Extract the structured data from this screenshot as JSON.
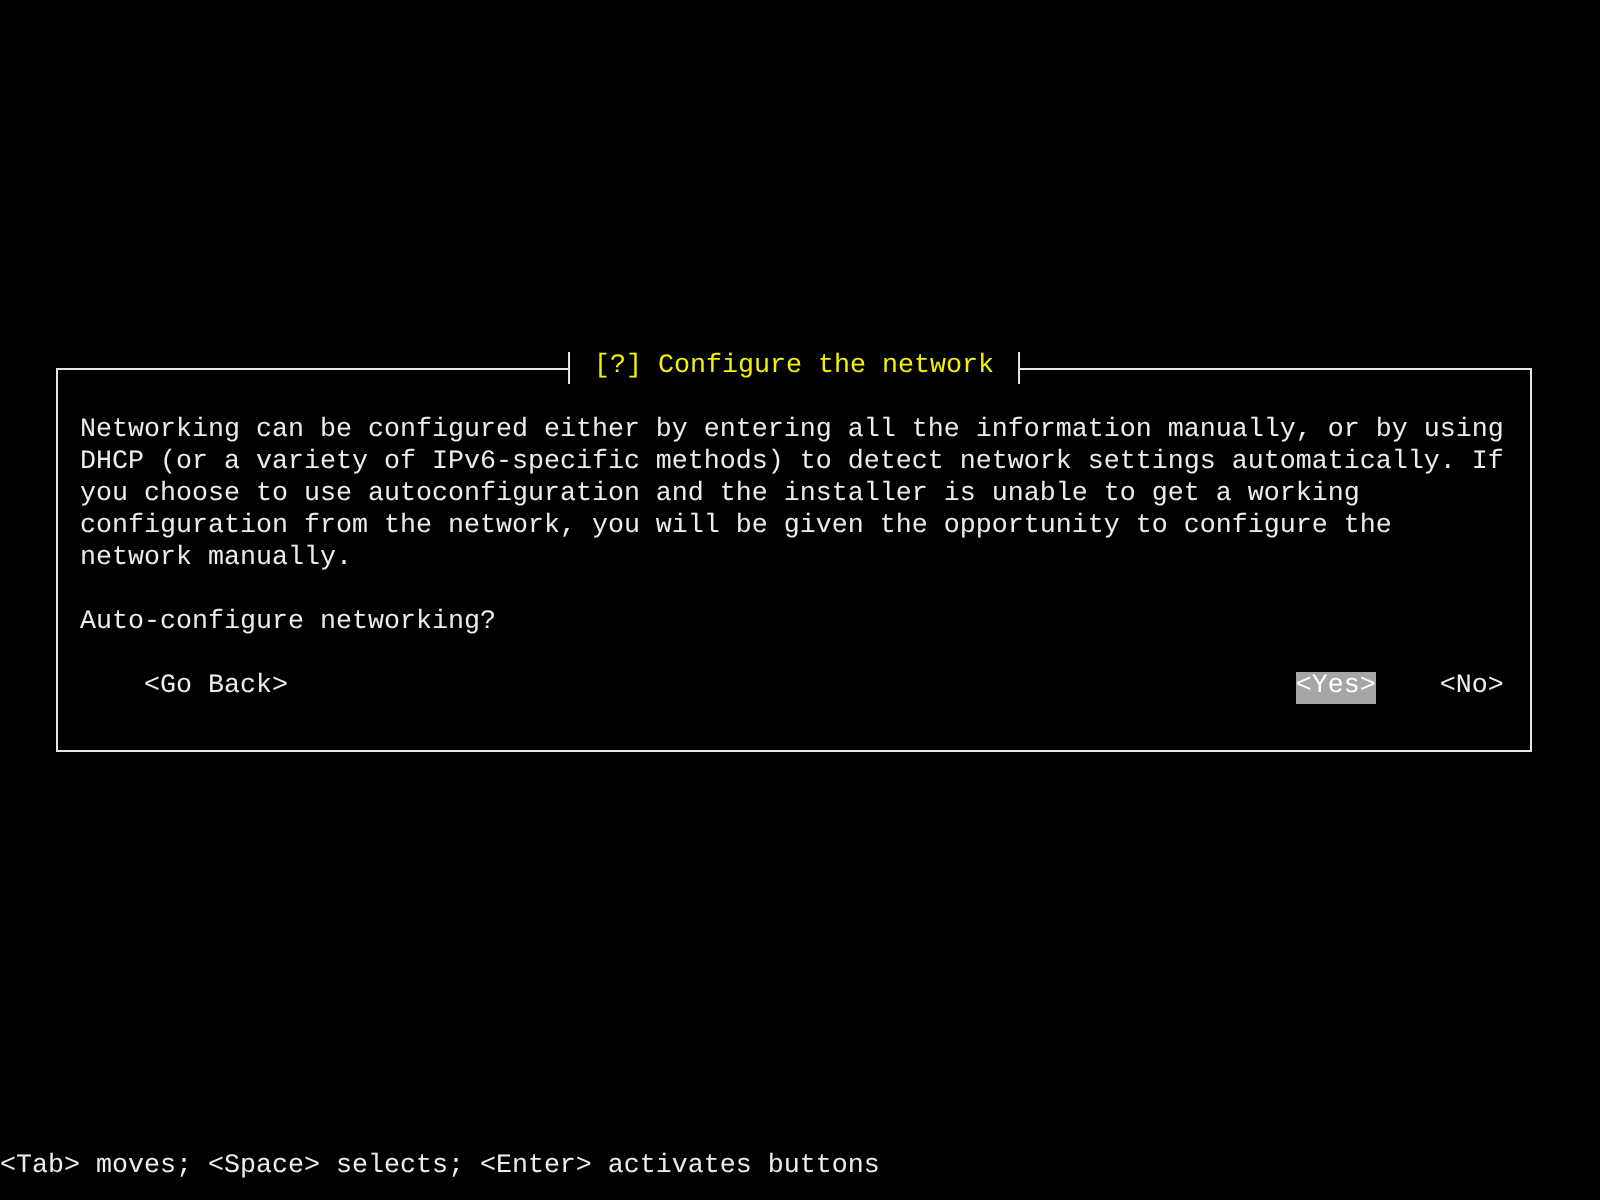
{
  "dialog": {
    "title": "[?] Configure the network",
    "message": "Networking can be configured either by entering all the information manually, or by using DHCP (or a variety of IPv6-specific methods) to detect network settings automatically. If you choose to use autoconfiguration and the installer is unable to get a working configuration from the network, you will be given the opportunity to configure the network manually.",
    "question": "Auto-configure networking?",
    "buttons": [
      {
        "label": "<Go Back>",
        "selected": false
      },
      {
        "label": "<Yes>",
        "selected": true
      },
      {
        "label": "<No>",
        "selected": false
      }
    ]
  },
  "footer": "<Tab> moves; <Space> selects; <Enter> activates buttons"
}
